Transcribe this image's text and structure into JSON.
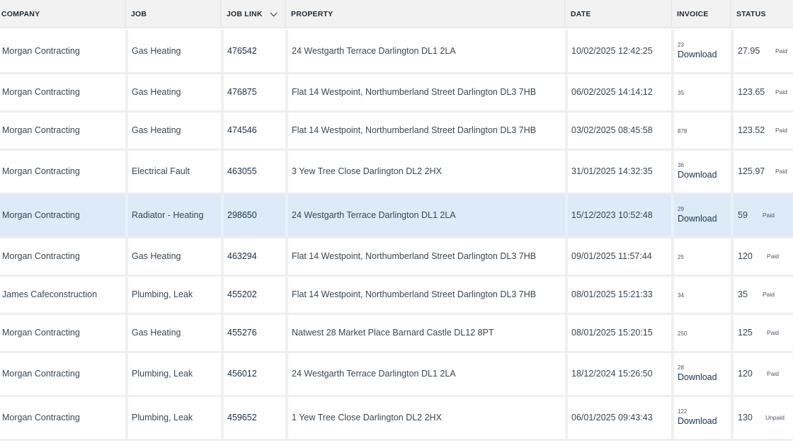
{
  "headers": {
    "company": "COMPANY",
    "job": "JOB",
    "job_link": "JOB LINK",
    "property": "PROPERTY",
    "date": "DATE",
    "invoice": "INVOICE",
    "status": "STATUS"
  },
  "rows": [
    {
      "company": "Morgan Contracting",
      "job": "Gas Heating",
      "job_link": "476542",
      "property": "24 Westgarth Terrace Darlington DL1 2LA",
      "date": "10/02/2025 12:42:25",
      "invoice_no": "23",
      "download": "Download",
      "amount": "27.95",
      "status": "Paid"
    },
    {
      "company": "Morgan Contracting",
      "job": "Gas Heating",
      "job_link": "476875",
      "property": "Flat 14 Westpoint, Northumberland Street Darlington DL3 7HB",
      "date": "06/02/2025 14:14:12",
      "invoice_no": "35",
      "download": "",
      "amount": "123.65",
      "status": "Paid"
    },
    {
      "company": "Morgan Contracting",
      "job": "Gas Heating",
      "job_link": "474546",
      "property": "Flat 14 Westpoint, Northumberland Street Darlington DL3 7HB",
      "date": "03/02/2025 08:45:58",
      "invoice_no": "878",
      "download": "",
      "amount": "123.52",
      "status": "Paid"
    },
    {
      "company": "Morgan Contracting",
      "job": "Electrical Fault",
      "job_link": "463055",
      "property": "3 Yew Tree Close Darlington DL2 2HX",
      "date": "31/01/2025 14:32:35",
      "invoice_no": "36",
      "download": "Download",
      "amount": "125.97",
      "status": "Paid"
    },
    {
      "company": "Morgan Contracting",
      "job": "Radiator - Heating",
      "job_link": "298650",
      "property": "24 Westgarth Terrace Darlington DL1 2LA",
      "date": "15/12/2023 10:52:48",
      "invoice_no": "29",
      "download": "Download",
      "amount": "59",
      "status": "Paid",
      "highlighted": true
    },
    {
      "company": "Morgan Contracting",
      "job": "Gas Heating",
      "job_link": "463294",
      "property": "Flat 14 Westpoint, Northumberland Street Darlington DL3 7HB",
      "date": "09/01/2025 11:57:44",
      "invoice_no": "25",
      "download": "",
      "amount": "120",
      "status": "Paid"
    },
    {
      "company": "James Cafeconstruction",
      "job": "Plumbing, Leak",
      "job_link": "455202",
      "property": "Flat 14 Westpoint, Northumberland Street Darlington DL3 7HB",
      "date": "08/01/2025 15:21:33",
      "invoice_no": "34",
      "download": "",
      "amount": "35",
      "status": "Paid"
    },
    {
      "company": "Morgan Contracting",
      "job": "Gas Heating",
      "job_link": "455276",
      "property": "Natwest 28 Market Place Barnard Castle DL12 8PT",
      "date": "08/01/2025 15:20:15",
      "invoice_no": "250",
      "download": "",
      "amount": "125",
      "status": "Paid"
    },
    {
      "company": "Morgan Contracting",
      "job": "Plumbing, Leak",
      "job_link": "456012",
      "property": "24 Westgarth Terrace Darlington DL1 2LA",
      "date": "18/12/2024 15:26:50",
      "invoice_no": "28",
      "download": "Download",
      "amount": "120",
      "status": "Paid"
    },
    {
      "company": "Morgan Contracting",
      "job": "Plumbing, Leak",
      "job_link": "459652",
      "property": "1 Yew Tree Close Darlington DL2 2HX",
      "date": "06/01/2025 09:43:43",
      "invoice_no": "122",
      "download": "Download",
      "amount": "130",
      "status": "Unpaid"
    }
  ]
}
